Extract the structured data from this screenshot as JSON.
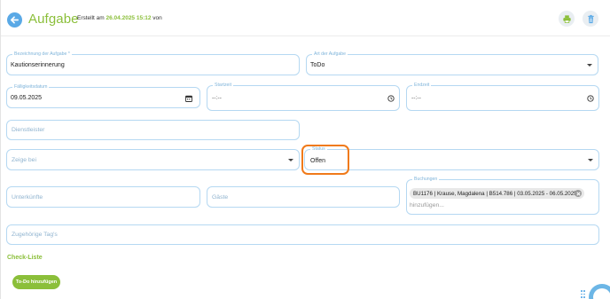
{
  "header": {
    "title": "Aufgabe",
    "created_prefix": "Erstellt am",
    "created_date": "26.04.2025 15:12",
    "created_suffix": "von"
  },
  "icons": {
    "back": "arrow-left-icon",
    "print": "printer-icon",
    "delete": "trash-icon",
    "calendar": "calendar-icon",
    "clock": "clock-icon",
    "dropdown": "chevron-down-icon",
    "chip_remove": "close-circle-icon"
  },
  "colors": {
    "brand_green": "#8bbf3a",
    "accent_blue": "#5aa9e6",
    "field_border": "#b5d8f2",
    "highlight": "#f07a1a"
  },
  "fields": {
    "bezeichnung": {
      "label": "Bezeichnung der Aufgabe *",
      "value": "Kautionserinnerung"
    },
    "art": {
      "label": "Art der Aufgabe",
      "value": "ToDo"
    },
    "faelligkeit": {
      "label": "Fälligkeitsdatum",
      "value": "09.05.2025"
    },
    "startzeit": {
      "label": "Startzeit",
      "placeholder": "--:--"
    },
    "endzeit": {
      "label": "Endzeit",
      "placeholder": "--:--"
    },
    "dienstleister": {
      "placeholder": "Dienstleister"
    },
    "zeige_bei": {
      "placeholder": "Zeige bei"
    },
    "status": {
      "label": "Status",
      "value": "Offen"
    },
    "unterkuenfte": {
      "placeholder": "Unterkünfte"
    },
    "gaeste": {
      "placeholder": "Gäste"
    },
    "buchungen": {
      "label": "Buchungen",
      "chip": "BU1176 | Krause, Magdalena | B514.786 | 03.05.2025 - 06.05.2025",
      "placeholder": "hinzufügen..."
    },
    "tags": {
      "placeholder": "Zugehörige Tag's"
    }
  },
  "checklist": {
    "title": "Check-Liste",
    "add_button": "To-Do hinzufügen"
  }
}
